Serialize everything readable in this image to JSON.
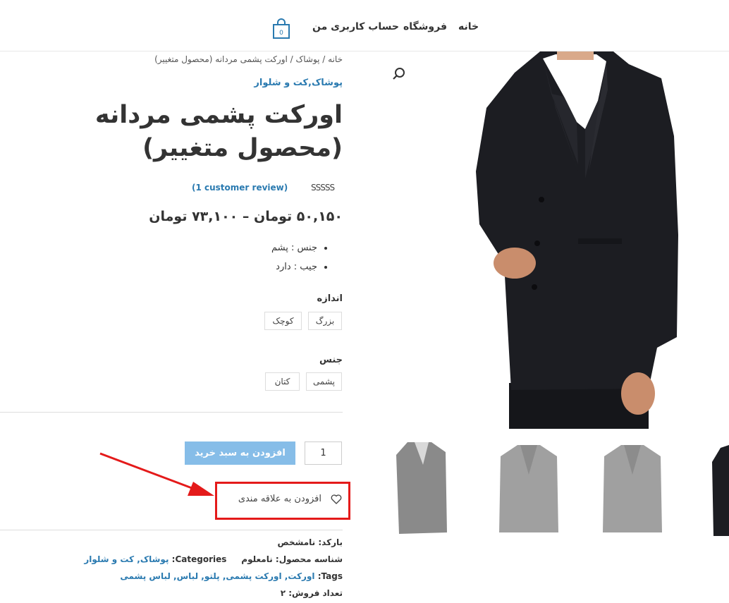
{
  "header": {
    "nav": [
      "خانه",
      "فروشگاه",
      "حساب کاربری من"
    ],
    "cart_count": "0"
  },
  "breadcrumb": "خانه / پوشاک / اورکت پشمی مردانه (محصول متغییر)",
  "categories": "پوشاک,کت و شلوار",
  "product": {
    "title": "اورکت پشمی مردانه (محصول متغییر)",
    "stars": "SSSSS",
    "reviews": "(1 customer review)",
    "price": "۵۰,۱۵۰ تومان – ۷۳,۱۰۰ تومان",
    "features": [
      "جنس : پشم",
      "جیب : دارد"
    ]
  },
  "attributes": {
    "size": {
      "label": "اندازه",
      "options": [
        "بزرگ",
        "کوچک"
      ]
    },
    "material": {
      "label": "جنس",
      "options": [
        "پشمی",
        "کتان"
      ]
    }
  },
  "cart": {
    "quantity": "1",
    "add_label": "افزودن به سبد خرید"
  },
  "wishlist": {
    "label": "افزودن به علاقه مندی"
  },
  "meta": {
    "barcode": "بارکد: نامشخص",
    "sku": "شناسه محصول: نامعلوم",
    "categories_label": "Categories:",
    "categories_value": "پوشاک, کت و شلوار",
    "tags_label": "Tags:",
    "tags_value": "اورکت, اورکت پشمی, پلتو, لباس, لباس پشمی",
    "sales": "تعداد فروش: ۲"
  },
  "colors": {
    "accent": "#2a7ab0",
    "button": "#86bde8",
    "highlight": "#e41a1a",
    "coat": "#1c1d22"
  }
}
